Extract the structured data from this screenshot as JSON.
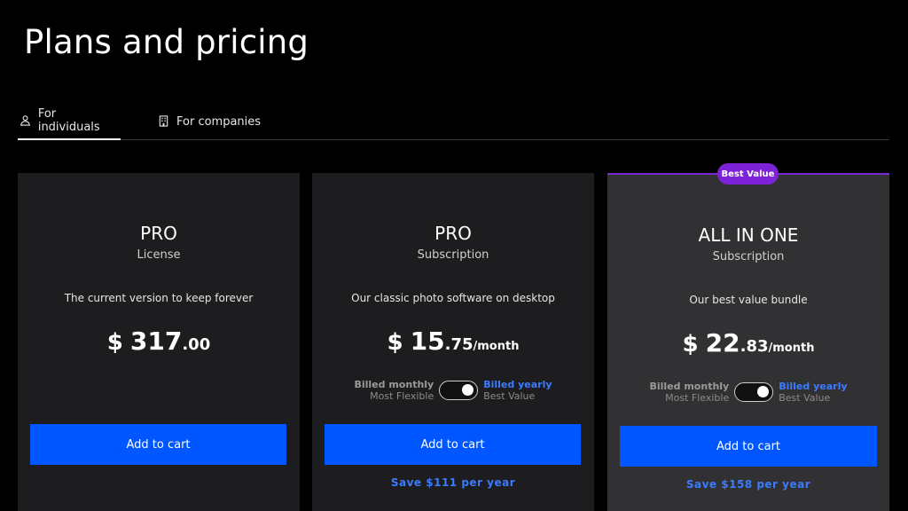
{
  "page": {
    "title": "Plans and pricing"
  },
  "tabs": [
    {
      "label": "For individuals",
      "icon": "person-icon",
      "active": true
    },
    {
      "label": "For companies",
      "icon": "building-icon",
      "active": false
    }
  ],
  "badge": {
    "label": "Best Value",
    "color": "#7d22d6"
  },
  "colors": {
    "accent": "#0057ff",
    "link": "#3b7bff"
  },
  "plans": [
    {
      "name": "PRO",
      "type": "License",
      "description": "The current version to keep forever",
      "currency": "$",
      "price_main": "317",
      "price_cents": ".00",
      "cart_label": "Add to cart"
    },
    {
      "name": "PRO",
      "type": "Subscription",
      "description": "Our classic photo software on desktop",
      "currency": "$",
      "price_main": "15",
      "price_cents": ".75",
      "period": "/month",
      "billing": {
        "monthly_label": "Billed monthly",
        "monthly_sub": "Most Flexible",
        "yearly_label": "Billed yearly",
        "yearly_sub": "Best Value",
        "yearly_selected": true
      },
      "cart_label": "Add to cart",
      "savings": "Save $111 per year"
    },
    {
      "name": "ALL IN ONE",
      "type": "Subscription",
      "description": "Our best value bundle",
      "currency": "$",
      "price_main": "22",
      "price_cents": ".83",
      "period": "/month",
      "billing": {
        "monthly_label": "Billed monthly",
        "monthly_sub": "Most Flexible",
        "yearly_label": "Billed yearly",
        "yearly_sub": "Best Value",
        "yearly_selected": true
      },
      "cart_label": "Add to cart",
      "savings": "Save $158 per year"
    }
  ]
}
